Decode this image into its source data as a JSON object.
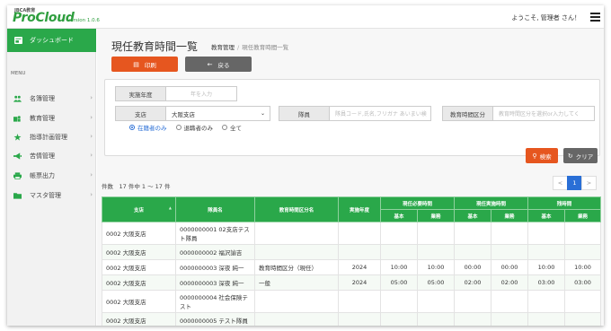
{
  "header": {
    "logo_small": "JBCA教育",
    "logo_main": "ProCloud",
    "version": "version 1.0.6",
    "welcome": "ようこそ, 管理者 さん！"
  },
  "sidebar": {
    "dashboard": "ダッシュボード",
    "menu_label": "MENU",
    "items": [
      {
        "label": "名簿管理",
        "icon": "users-icon"
      },
      {
        "label": "教育管理",
        "icon": "graduation-icon"
      },
      {
        "label": "指導計画管理",
        "icon": "star-icon"
      },
      {
        "label": "苦情管理",
        "icon": "megaphone-icon"
      },
      {
        "label": "帳票出力",
        "icon": "printer-icon"
      },
      {
        "label": "マスタ管理",
        "icon": "folder-icon"
      }
    ]
  },
  "page": {
    "title": "現任教育時間一覧",
    "breadcrumb_parent": "教育管理",
    "breadcrumb_current": "現任教育時間一覧"
  },
  "toolbar": {
    "print_label": "印刷",
    "back_label": "戻る"
  },
  "filters": {
    "year_label": "実施年度",
    "year_placeholder": "年を入力",
    "branch_label": "支店",
    "branch_value": "大阪支店",
    "staff_label": "隊員",
    "staff_placeholder": "隊員コード,氏名,フリガナ あいまい検",
    "category_label": "教育時間区分",
    "category_placeholder": "教育時間区分を選択or入力してく",
    "radios": [
      {
        "label": "在籍者のみ",
        "checked": true
      },
      {
        "label": "退職者のみ",
        "checked": false
      },
      {
        "label": "全て",
        "checked": false
      }
    ],
    "search_label": "検索",
    "clear_label": "クリア"
  },
  "results": {
    "count_text": "件数　17 件中 1 〜 17 件",
    "pager": {
      "prev": "<",
      "current": "1",
      "next": ">"
    }
  },
  "table": {
    "headers": {
      "branch": "支店",
      "staff": "隊員名",
      "category": "教育時間区分名",
      "year": "実施年度",
      "required": "現任必要時間",
      "actual": "現任実施時間",
      "remaining": "残時間",
      "basic": "基本",
      "work": "業務"
    },
    "rows": [
      {
        "branch": "0002 大阪支店",
        "staff": "0000000001 02支店テスト隊員",
        "category": "",
        "year": "",
        "req_basic": "",
        "req_work": "",
        "act_basic": "",
        "act_work": "",
        "rem_basic": "",
        "rem_work": ""
      },
      {
        "branch": "0002 大阪支店",
        "staff": "0000000002 福沢諭吉",
        "category": "",
        "year": "",
        "req_basic": "",
        "req_work": "",
        "act_basic": "",
        "act_work": "",
        "rem_basic": "",
        "rem_work": ""
      },
      {
        "branch": "0002 大阪支店",
        "staff": "0000000003 深夜 純一",
        "category": "教育時間区分（現任）",
        "year": "2024",
        "req_basic": "10:00",
        "req_work": "10:00",
        "act_basic": "00:00",
        "act_work": "00:00",
        "rem_basic": "10:00",
        "rem_work": "10:00"
      },
      {
        "branch": "0002 大阪支店",
        "staff": "0000000003 深夜 純一",
        "category": "一般",
        "year": "2024",
        "req_basic": "05:00",
        "req_work": "05:00",
        "act_basic": "02:00",
        "act_work": "02:00",
        "rem_basic": "03:00",
        "rem_work": "03:00"
      },
      {
        "branch": "0002 大阪支店",
        "staff": "0000000004 社会保険テスト",
        "category": "",
        "year": "",
        "req_basic": "",
        "req_work": "",
        "act_basic": "",
        "act_work": "",
        "rem_basic": "",
        "rem_work": ""
      },
      {
        "branch": "0002 大阪支店",
        "staff": "0000000005 テスト隊員",
        "category": "",
        "year": "",
        "req_basic": "",
        "req_work": "",
        "act_basic": "",
        "act_work": "",
        "rem_basic": "",
        "rem_work": ""
      }
    ]
  },
  "colors": {
    "green": "#2aa84a",
    "orange": "#e6561f",
    "gray_button": "#666666",
    "blue": "#2a6fd6"
  }
}
